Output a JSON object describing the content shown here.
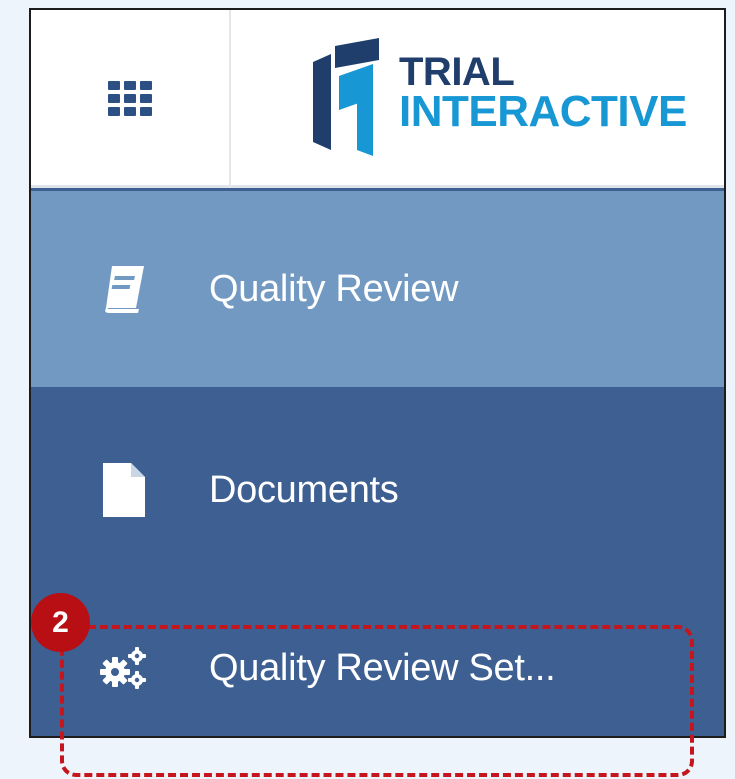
{
  "header": {
    "apps_icon": "grid-apps-icon",
    "logo": {
      "line1": "TRIAL",
      "line2": "INTERACTIVE",
      "colors": {
        "dark": "#1f3e6b",
        "light": "#1797d3"
      }
    }
  },
  "sidebar": {
    "items": [
      {
        "label": "Quality Review",
        "icon": "book-icon",
        "active": true
      },
      {
        "label": "Documents",
        "icon": "document-icon",
        "active": false
      },
      {
        "label": "Quality Review Set...",
        "icon": "gears-icon",
        "active": false
      }
    ]
  },
  "annotation": {
    "step_number": "2",
    "color": "#c4161c"
  },
  "colors": {
    "sidebar_bg": "#3d5f91",
    "active_bg": "#7299c2",
    "header_bg": "#ffffff",
    "page_bg": "#eef4fb"
  }
}
